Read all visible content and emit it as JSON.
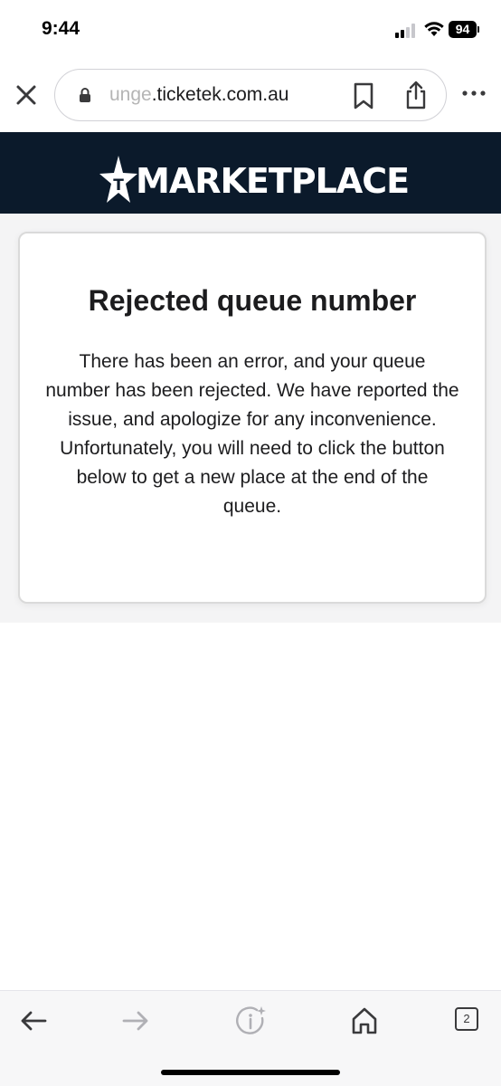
{
  "status_bar": {
    "time": "9:44",
    "battery": "94"
  },
  "browser": {
    "url_faded": "unge",
    "url_main": ".ticketek.com.au",
    "icons": [
      "close-icon",
      "lock-icon",
      "bookmark-icon",
      "share-icon",
      "more-icon"
    ]
  },
  "site": {
    "logo_text": "MARKETPLACE",
    "logo_mark": "T",
    "header_color": "#0b1a2b"
  },
  "error_card": {
    "title": "Rejected queue number",
    "message": "There has been an error, and your queue number has been rejected. We have reported the issue, and apologize for any inconvenience. Unfortunately, you will need to click the button below to get a new place at the end of the queue."
  },
  "toolbar": {
    "tab_count": "2",
    "icons": [
      "back-icon",
      "forward-icon",
      "info-sparkle-icon",
      "home-icon",
      "tabs-icon"
    ]
  }
}
